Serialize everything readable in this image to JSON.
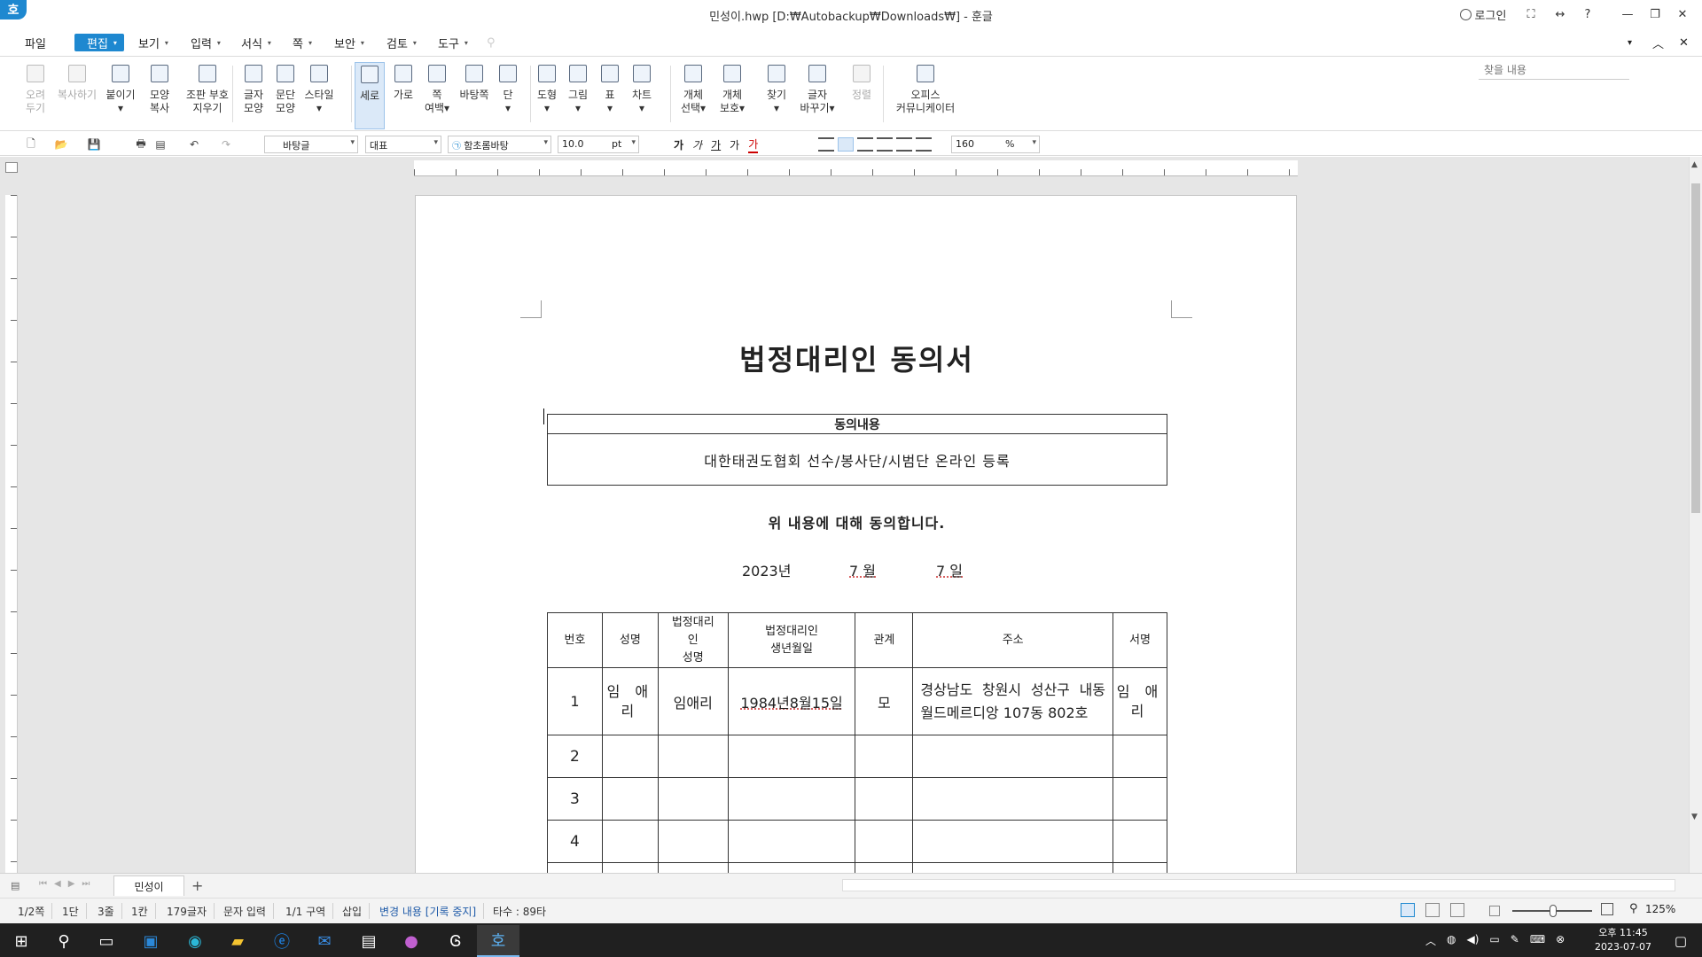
{
  "window": {
    "app_logo": "호",
    "title": "민성이.hwp [D:₩Autobackup₩Downloads₩] - 훈글",
    "login_label": "로그인",
    "help_label": "?"
  },
  "menu": {
    "items": [
      "파일",
      "편집",
      "보기",
      "입력",
      "서식",
      "쪽",
      "보안",
      "검토",
      "도구"
    ],
    "active_index": 1,
    "find_placeholder": "찾을 내용"
  },
  "ribbon": {
    "buttons": [
      {
        "label1": "오려",
        "label2": "두기",
        "icon": "scissors-icon",
        "disabled": true
      },
      {
        "label1": "복사하기",
        "label2": "",
        "icon": "copy-icon",
        "disabled": true
      },
      {
        "label1": "붙이기",
        "label2": "▾",
        "icon": "paste-icon",
        "disabled": false
      },
      {
        "label1": "모양",
        "label2": "복사",
        "icon": "format-copy-icon",
        "disabled": false
      },
      {
        "label1": "조판 부호",
        "label2": "지우기",
        "icon": "clear-marks-icon",
        "disabled": false
      },
      {
        "label1": "글자",
        "label2": "모양",
        "icon": "char-shape-icon",
        "disabled": false
      },
      {
        "label1": "문단",
        "label2": "모양",
        "icon": "para-shape-icon",
        "disabled": false
      },
      {
        "label1": "스타일",
        "label2": "▾",
        "icon": "style-icon",
        "disabled": false
      },
      {
        "label1": "세로",
        "label2": "",
        "icon": "portrait-icon",
        "disabled": false,
        "selected": true
      },
      {
        "label1": "가로",
        "label2": "",
        "icon": "landscape-icon",
        "disabled": false
      },
      {
        "label1": "쪽",
        "label2": "여백▾",
        "icon": "page-margin-icon",
        "disabled": false
      },
      {
        "label1": "바탕쪽",
        "label2": "",
        "icon": "master-page-icon",
        "disabled": false
      },
      {
        "label1": "단",
        "label2": "▾",
        "icon": "columns-icon",
        "disabled": false
      },
      {
        "label1": "도형",
        "label2": "▾",
        "icon": "shape-icon",
        "disabled": false
      },
      {
        "label1": "그림",
        "label2": "▾",
        "icon": "picture-icon",
        "disabled": false
      },
      {
        "label1": "표",
        "label2": "▾",
        "icon": "table-icon",
        "disabled": false
      },
      {
        "label1": "차트",
        "label2": "▾",
        "icon": "chart-icon",
        "disabled": false
      },
      {
        "label1": "개체",
        "label2": "선택▾",
        "icon": "object-select-icon",
        "disabled": false
      },
      {
        "label1": "개체",
        "label2": "보호▾",
        "icon": "object-protect-icon",
        "disabled": false
      },
      {
        "label1": "찾기",
        "label2": "▾",
        "icon": "find-icon",
        "disabled": false
      },
      {
        "label1": "글자",
        "label2": "바꾸기▾",
        "icon": "replace-icon",
        "disabled": false
      },
      {
        "label1": "정렬",
        "label2": "",
        "icon": "sort-icon",
        "disabled": true
      },
      {
        "label1": "오피스",
        "label2": "커뮤니케이터",
        "icon": "office-communicator-icon",
        "disabled": false
      }
    ]
  },
  "format_toolbar": {
    "style": "바탕글",
    "lang": "대표",
    "font": "함초롬바탕",
    "size": "10.0",
    "unit": "pt",
    "zoom": "160",
    "zoom_unit": "%"
  },
  "document": {
    "title": "법정대리인 동의서",
    "consent_header": "동의내용",
    "consent_body": "대한태권도협회 선수/봉사단/시범단 온라인 등록",
    "agree_text": "위 내용에 대해 동의합니다.",
    "date_year": "2023년",
    "date_month": "7 월",
    "date_day": "7 일",
    "table": {
      "headers": [
        "번호",
        "성명",
        "법정대리\n인\n성명",
        "법정대리인\n생년월일",
        "관계",
        "주소",
        "서명"
      ],
      "rows": [
        [
          "1",
          "임 애\n리",
          "임애리",
          "1984년8월15일",
          "모",
          "경상남도 창원시 성산구 내동 월드메르디앙 107동 802호",
          "임 애\n리"
        ],
        [
          "2",
          "",
          "",
          "",
          "",
          "",
          ""
        ],
        [
          "3",
          "",
          "",
          "",
          "",
          "",
          ""
        ],
        [
          "4",
          "",
          "",
          "",
          "",
          "",
          ""
        ],
        [
          "",
          "",
          "",
          "",
          "",
          "",
          ""
        ]
      ]
    }
  },
  "tabs": {
    "doc_tab": "민성이",
    "add": "+"
  },
  "status": {
    "page": "1/2쪽",
    "column": "1단",
    "line": "3줄",
    "col": "1칸",
    "chars": "179글자",
    "mode": "문자 입력",
    "section": "1/1 구역",
    "insert": "삽입",
    "track": "변경 내용 [기록 중지]",
    "typing": "타수 : 89타",
    "zoom": "125%"
  },
  "taskbar": {
    "time": "오후 11:45",
    "date": "2023-07-07"
  }
}
